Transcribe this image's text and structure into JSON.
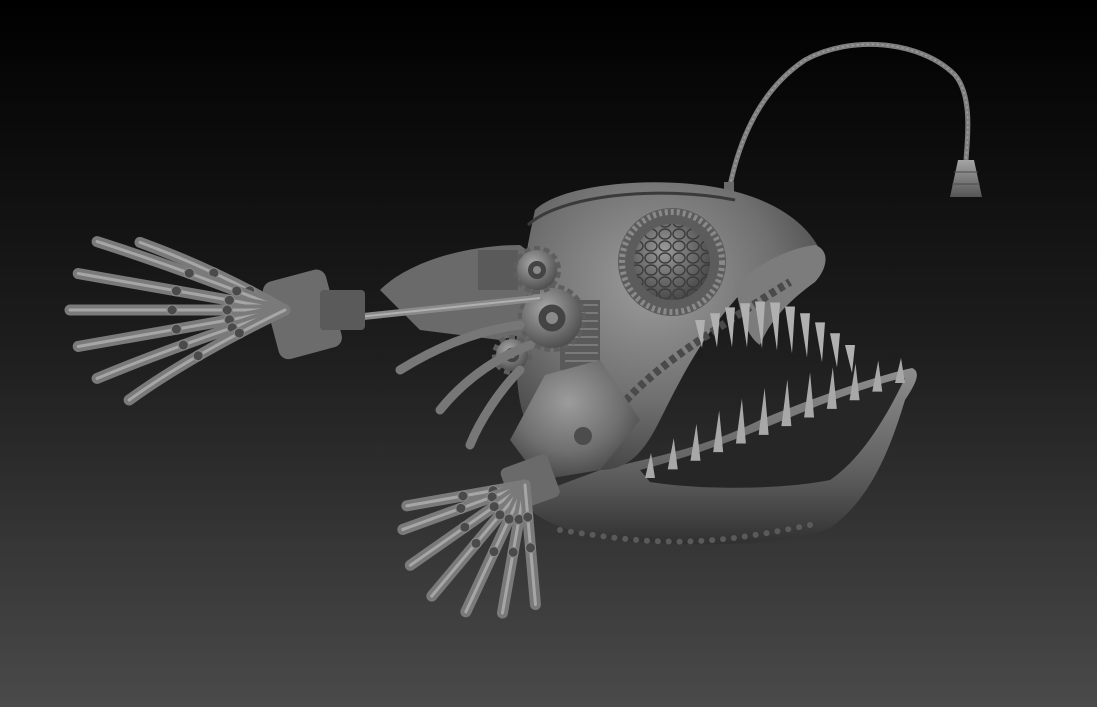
{
  "scene": {
    "subject": "mechanical-anglerfish-sculpt",
    "render_style": "grey-clay-matcap",
    "colors": {
      "background_top": "#000000",
      "background_bottom": "#4a4a4a",
      "clay_light": "#9a9a9a",
      "clay_mid": "#6e6e6e",
      "clay_dark": "#3a3a3a",
      "mouth_interior": "#2a2a2a"
    },
    "parts": {
      "upper_fin_fingers": 7,
      "lower_fin_fingers": 7,
      "upper_teeth": 11,
      "lower_teeth": 12,
      "gears": 3
    }
  }
}
